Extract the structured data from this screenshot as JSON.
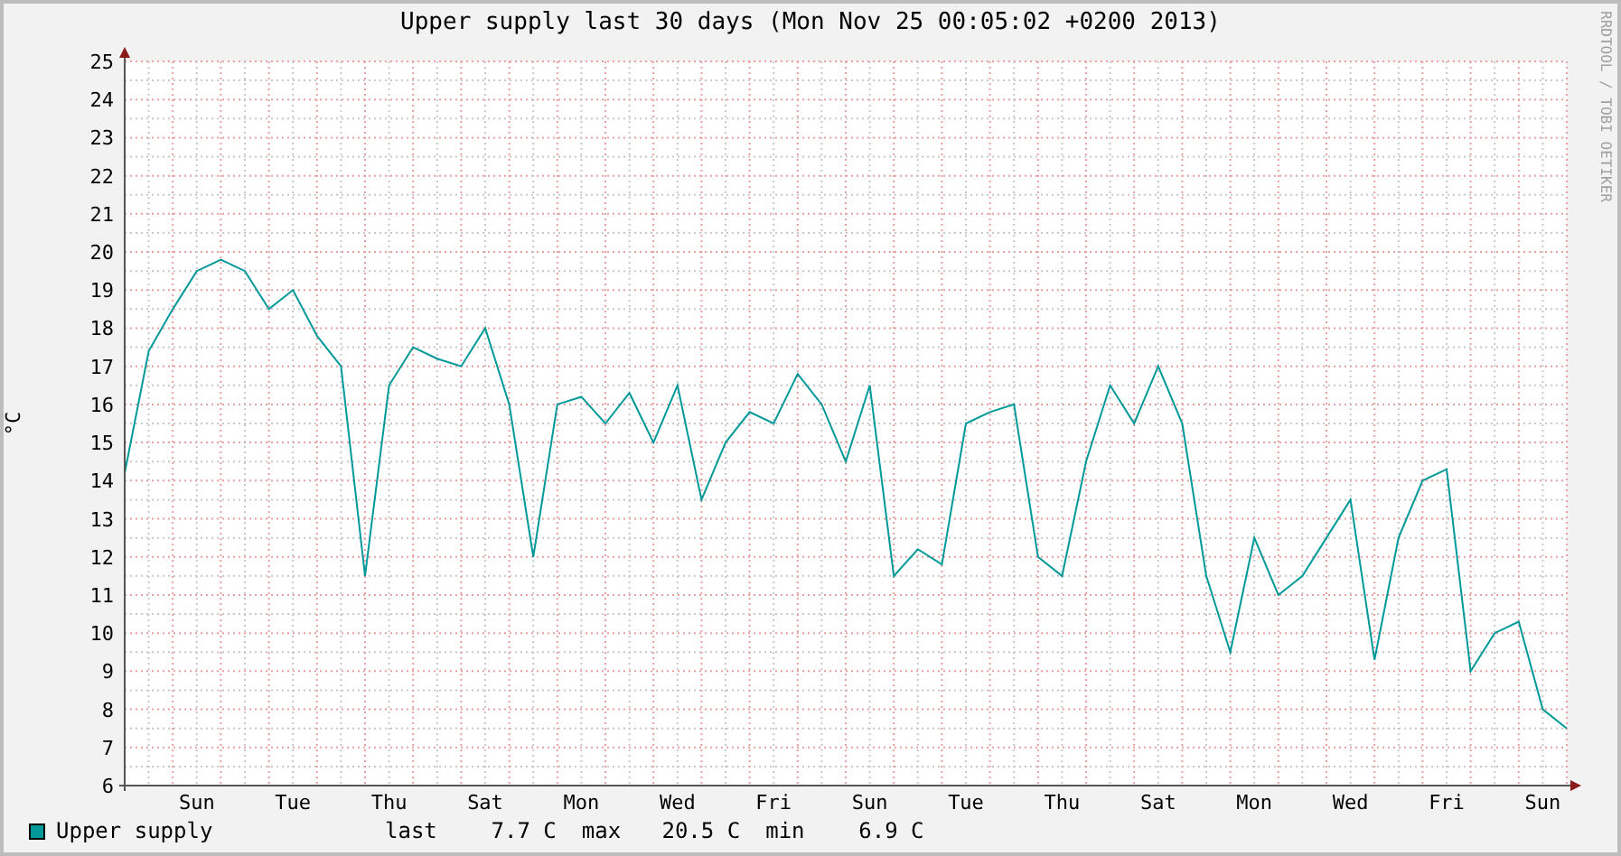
{
  "title": "Upper supply last 30 days (Mon Nov 25 00:05:02 +0200 2013)",
  "credit": "RRDTOOL / TOBI OETIKER",
  "chart_data": {
    "type": "line",
    "grid": true,
    "ylabel": "°C",
    "ylim": [
      6,
      25
    ],
    "yticks": [
      6,
      7,
      8,
      9,
      10,
      11,
      12,
      13,
      14,
      15,
      16,
      17,
      18,
      19,
      20,
      21,
      22,
      23,
      24,
      25
    ],
    "categories": [
      null,
      null,
      null,
      "Sun",
      null,
      null,
      null,
      "Tue",
      null,
      null,
      null,
      "Thu",
      null,
      null,
      null,
      "Sat",
      null,
      null,
      null,
      "Mon",
      null,
      null,
      null,
      "Wed",
      null,
      null,
      null,
      "Fri",
      null,
      null,
      null,
      "Sun",
      null,
      null,
      null,
      "Tue",
      null,
      null,
      null,
      "Thu",
      null,
      null,
      null,
      "Sat",
      null,
      null,
      null,
      "Mon",
      null,
      null,
      null,
      "Wed",
      null,
      null,
      null,
      "Fri",
      null,
      null,
      null,
      "Sun",
      null
    ],
    "series": [
      {
        "name": "Upper supply",
        "color": "#009999",
        "values": [
          14.2,
          17.4,
          18.5,
          19.5,
          19.8,
          19.5,
          18.5,
          19.0,
          17.8,
          17.0,
          11.5,
          16.5,
          17.5,
          17.2,
          17.0,
          18.0,
          16.0,
          12.0,
          16.0,
          16.2,
          15.5,
          16.3,
          15.0,
          16.5,
          13.5,
          15.0,
          15.8,
          15.5,
          16.8,
          16.0,
          14.5,
          16.5,
          11.5,
          12.2,
          11.8,
          15.5,
          15.8,
          16.0,
          12.0,
          11.5,
          14.5,
          16.5,
          15.5,
          17.0,
          15.5,
          11.5,
          9.5,
          12.5,
          11.0,
          11.5,
          12.5,
          13.5,
          9.3,
          12.5,
          14.0,
          14.3,
          9.0,
          10.0,
          10.3,
          8.0,
          7.5
        ]
      }
    ]
  },
  "legend": [
    {
      "stats": [
        {
          "name": "last",
          "value": "7.7 C"
        },
        {
          "name": "max",
          "value": "20.5 C"
        },
        {
          "name": "min",
          "value": "6.9 C"
        }
      ]
    }
  ]
}
